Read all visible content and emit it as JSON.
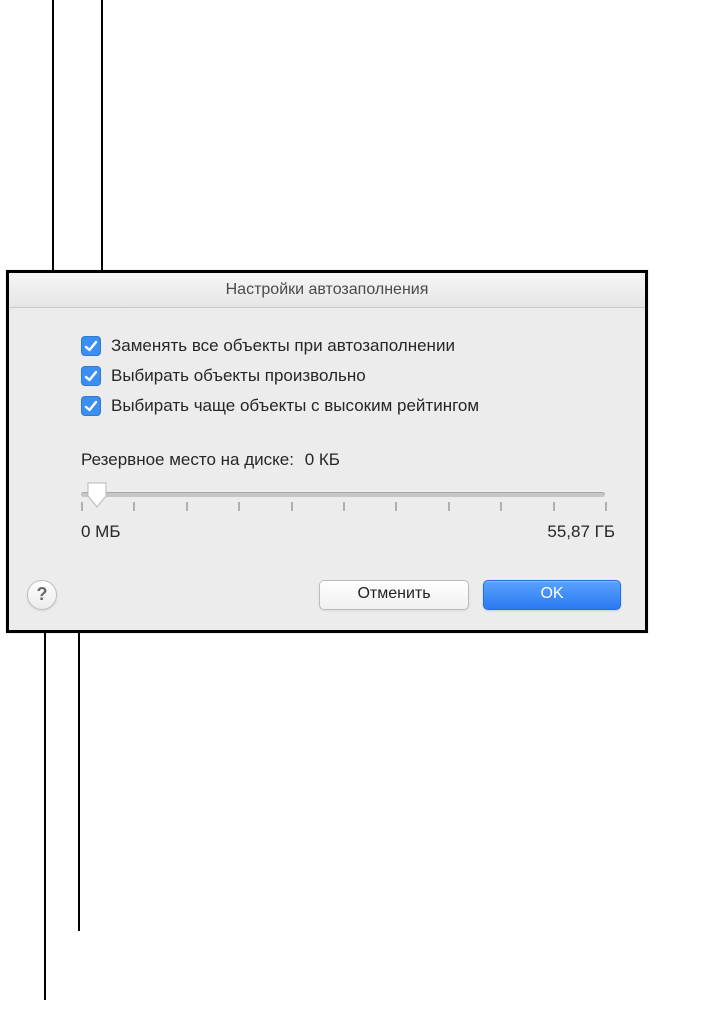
{
  "window": {
    "title": "Настройки автозаполнения"
  },
  "checkboxes": [
    {
      "label": "Заменять все объекты при автозаполнении",
      "checked": true
    },
    {
      "label": "Выбирать объекты произвольно",
      "checked": true
    },
    {
      "label": "Выбирать чаще объекты с высоким рейтингом",
      "checked": true
    }
  ],
  "reserve": {
    "label": "Резервное место на диске:",
    "value": "0 КБ",
    "min_label": "0 МБ",
    "max_label": "55,87 ГБ",
    "position_percent": 3
  },
  "buttons": {
    "help": "?",
    "cancel": "Отменить",
    "ok": "OK"
  },
  "icons": {
    "check": "check-icon",
    "help": "help-icon",
    "slider_thumb": "slider-thumb-icon"
  }
}
